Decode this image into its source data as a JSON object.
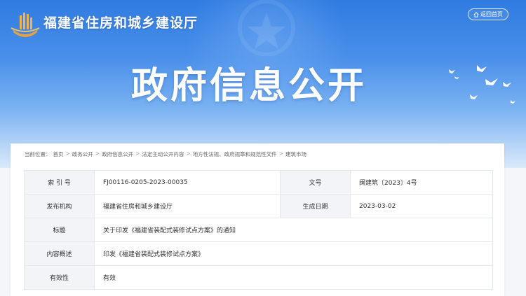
{
  "header": {
    "site_name": "福建省住房和城乡建设厅",
    "home_button": "返回首页",
    "page_heading": "政府信息公开"
  },
  "breadcrumb": {
    "prefix": "当前位置：",
    "items": [
      "首页",
      "政务公开",
      "政府信息公开",
      "法定主动公开内容",
      "地方性法规、政府规章和规范性文件",
      "建筑市场"
    ],
    "separator": ">"
  },
  "info": {
    "index_label": "索 引 号",
    "index_value": "FJ00116-0205-2023-00035",
    "docno_label": "文号",
    "docno_value": "闽建筑〔2023〕4号",
    "publisher_label": "发布机构",
    "publisher_value": "福建省住房和城乡建设厅",
    "date_label": "生成日期",
    "date_value": "2023-03-02",
    "title_label": "标题",
    "title_value": "关于印发《福建省装配式装修试点方案》的通知",
    "summary_label": "内容概述",
    "summary_value": "印发《福建省装配式装修试点方案》",
    "validity_label": "有效性",
    "validity_value": "有效"
  },
  "colors": {
    "banner_top": "#2f7be0",
    "banner_bottom": "#dbe9fb",
    "label_cell_bg": "#f2f4f7",
    "border": "#e4e8ef"
  },
  "icons": {
    "logo": "building-logo-icon",
    "home": "home-icon",
    "doves": "dove-icon"
  }
}
